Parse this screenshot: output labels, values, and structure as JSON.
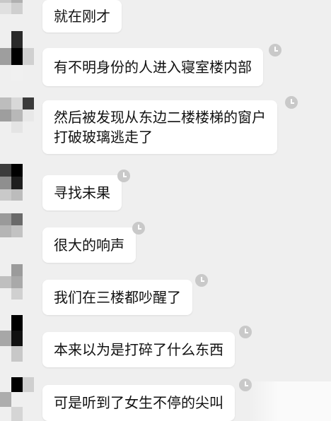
{
  "messages": [
    {
      "text": "就在刚才",
      "status_icon": ""
    },
    {
      "text": "有不明身份的人进入寝室楼内部",
      "status_icon": "clock-icon"
    },
    {
      "lines": [
        "然后被发现从东边二楼楼梯的窗户",
        "打破玻璃逃走了"
      ],
      "status_icon": "clock-icon"
    },
    {
      "text": "寻找未果",
      "status_icon": "clock-icon"
    },
    {
      "text": "很大的响声",
      "status_icon": "clock-icon"
    },
    {
      "text": "我们在三楼都吵醒了",
      "status_icon": "clock-icon"
    },
    {
      "text": "本来以为是打碎了什么东西",
      "status_icon": "clock-icon"
    },
    {
      "text": "可是听到了女生不停的尖叫",
      "status_icon": "clock-icon"
    }
  ],
  "colors": {
    "background": "#efefef",
    "bubble": "#ffffff",
    "text": "#111111",
    "pending_icon": "#c9c9c9"
  }
}
